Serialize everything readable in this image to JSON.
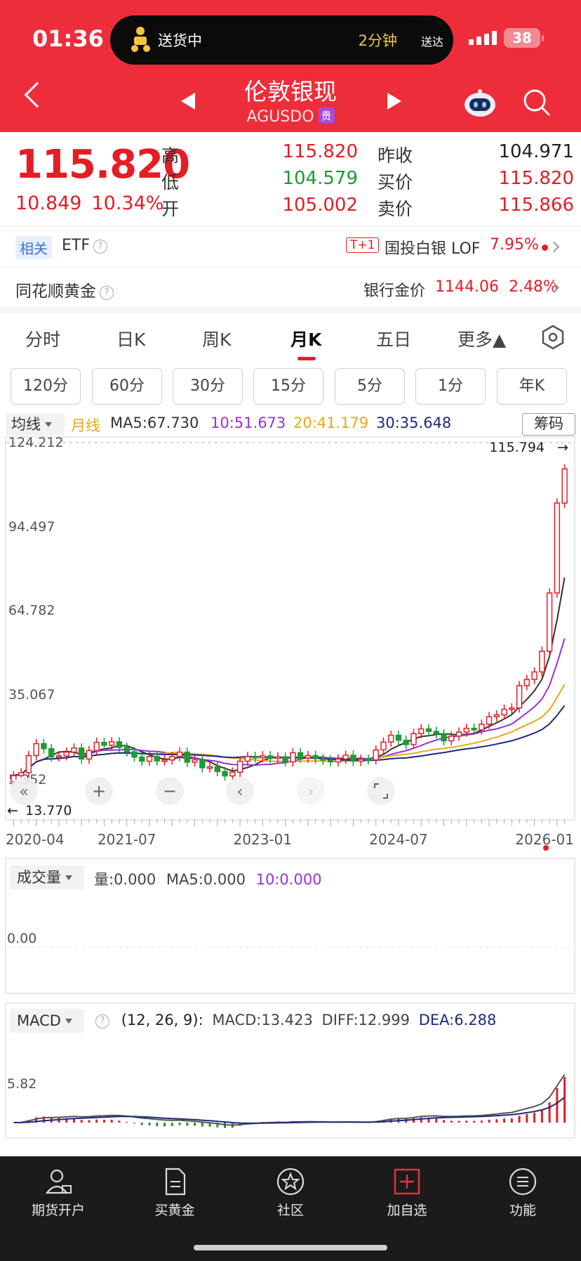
{
  "status_bar": {
    "time": "01:36",
    "delivery_text": "送货中",
    "delivery_eta": "2分钟",
    "delivery_suffix": "送达",
    "battery": "38"
  },
  "header": {
    "title": "伦敦银现",
    "code": "AGUSDO",
    "badge": "贵"
  },
  "quote": {
    "price": "115.820",
    "change": "10.849",
    "change_pct": "10.34%",
    "labels": {
      "high": "高",
      "low": "低",
      "open": "开",
      "prev_close": "昨收",
      "bid": "买价",
      "ask": "卖价"
    },
    "high": "115.820",
    "low": "104.579",
    "open": "105.002",
    "prev_close": "104.971",
    "bid": "115.820",
    "ask": "115.866"
  },
  "related": {
    "tag": "相关",
    "etf": "ETF",
    "t1": "T+1",
    "lof_name": "国投白银 LOF",
    "lof_pct": "7.95%"
  },
  "gold": {
    "name": "同花顺黄金",
    "bank_label": "银行金价",
    "bank_price": "1144.06",
    "bank_pct": "2.48%"
  },
  "tabs": [
    "分时",
    "日K",
    "周K",
    "月K",
    "五日",
    "更多▲"
  ],
  "active_tab": "月K",
  "periods": [
    "120分",
    "60分",
    "30分",
    "15分",
    "5分",
    "1分",
    "年K"
  ],
  "ma_legend": {
    "selector": "均线",
    "period": "月线",
    "ma5": "MA5:67.730",
    "ma10": "10:51.673",
    "ma20": "20:41.179",
    "ma30": "30:35.648",
    "chip_button": "筹码"
  },
  "colors": {
    "up": "#e41d25",
    "down": "#1a9c32",
    "ma5": "#333333",
    "ma10": "#9b30d9",
    "ma20": "#e8a81a",
    "ma30": "#1c2a80",
    "brand": "#ee2d3a"
  },
  "chart_data": [
    {
      "type": "candlestick",
      "title": "伦敦银现 月K",
      "x_ticks": [
        "2020-04",
        "2021-07",
        "2023-01",
        "2024-07",
        "2026-01"
      ],
      "y_ticks": [
        "124.212",
        "94.497",
        "64.782",
        "35.067",
        "5.352"
      ],
      "ylim": [
        5.352,
        124.212
      ],
      "max_label": "115.794",
      "min_label": "13.770",
      "approx_close": [
        17.9,
        18.8,
        24.3,
        28.1,
        26.5,
        23.9,
        24.2,
        25.4,
        26.7,
        23.2,
        25.9,
        28.5,
        27.6,
        28.7,
        26.9,
        25.5,
        23.8,
        22.5,
        24.0,
        22.6,
        22.9,
        24.0,
        25.4,
        22.2,
        22.9,
        20.4,
        20.7,
        19.2,
        17.8,
        19.0,
        22.5,
        24.0,
        23.6,
        24.2,
        23.4,
        23.9,
        22.3,
        25.2,
        23.5,
        24.3,
        23.3,
        22.9,
        22.3,
        23.2,
        24.4,
        22.5,
        23.1,
        22.9,
        26.1,
        28.6,
        30.8,
        29.2,
        27.8,
        31.3,
        32.8,
        32.0,
        31.2,
        29.0,
        30.5,
        31.8,
        33.0,
        32.5,
        34.3,
        36.7,
        37.3,
        39.1,
        39.5,
        46.6,
        48.6,
        51.0,
        57.6,
        76.2,
        104.9,
        115.8
      ]
    },
    {
      "type": "bar",
      "title": "成交量",
      "legend": {
        "selector": "成交量",
        "vol": "量:0.000",
        "ma5": "MA5:0.000",
        "ma10": "10:0.000"
      },
      "y_ticks": [
        "0.00"
      ],
      "values": []
    },
    {
      "type": "bar",
      "title": "MACD",
      "legend": {
        "selector": "MACD",
        "params": "(12, 26, 9):",
        "macd": "MACD:13.423",
        "diff": "DIFF:12.999",
        "dea": "DEA:6.288"
      },
      "y_ticks": [
        "5.82"
      ],
      "series": [
        {
          "name": "MACD",
          "values": []
        },
        {
          "name": "DIFF",
          "values": []
        },
        {
          "name": "DEA",
          "values": []
        }
      ]
    }
  ],
  "bottom_nav": [
    {
      "label": "期货开户",
      "icon": "user-icon"
    },
    {
      "label": "买黄金",
      "icon": "document-icon"
    },
    {
      "label": "社区",
      "icon": "community-icon"
    },
    {
      "label": "加自选",
      "icon": "add-watchlist-icon"
    },
    {
      "label": "功能",
      "icon": "menu-icon"
    }
  ]
}
